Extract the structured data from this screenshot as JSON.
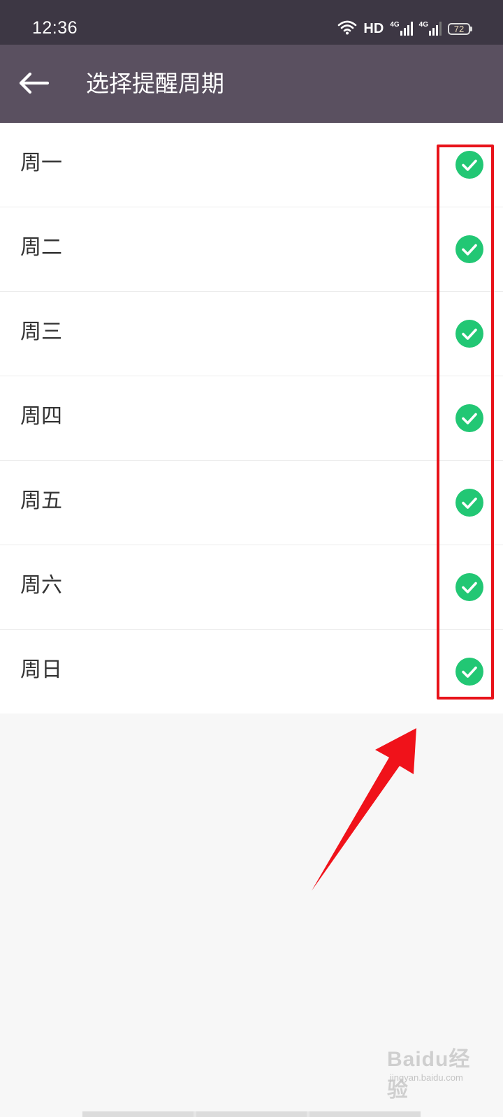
{
  "status_bar": {
    "time": "12:36",
    "hd_label": "HD",
    "network_1": "4G",
    "network_2": "4G",
    "battery_level": "72"
  },
  "header": {
    "back_icon": "arrow-left-icon",
    "title": "选择提醒周期"
  },
  "days": [
    {
      "label": "周一",
      "selected": true
    },
    {
      "label": "周二",
      "selected": true
    },
    {
      "label": "周三",
      "selected": true
    },
    {
      "label": "周四",
      "selected": true
    },
    {
      "label": "周五",
      "selected": true
    },
    {
      "label": "周六",
      "selected": true
    },
    {
      "label": "周日",
      "selected": true
    }
  ],
  "colors": {
    "status_bar_bg": "#3d3744",
    "app_bar_bg": "#5a5060",
    "check_green": "#22c774",
    "annotation_red": "#e8131a"
  },
  "watermark": {
    "logo": "Baidu经验",
    "domain": "jingyan.baidu.com"
  }
}
